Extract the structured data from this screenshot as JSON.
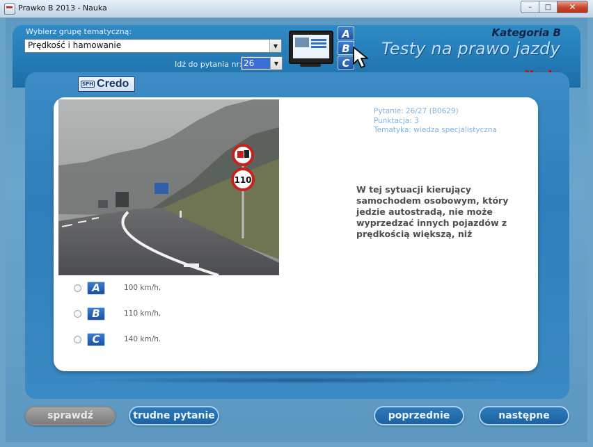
{
  "window": {
    "title": "Prawko B 2013 - Nauka",
    "min_glyph": "–",
    "max_glyph": "□",
    "close_glyph": "✕"
  },
  "header": {
    "group_label": "Wybierz grupę tematyczną:",
    "group_value": "Prędkość i hamowanie",
    "goto_label": "Idź do pytania nr:",
    "goto_value": "26",
    "logo_letters": [
      "A",
      "B",
      "C"
    ],
    "category": "Kategoria B",
    "app_title": "Testy na prawo jazdy",
    "mode": "Nauka"
  },
  "brand": {
    "badge": "SPH",
    "name": "Credo"
  },
  "question": {
    "meta_number": "Pytanie: 26/27 (B0629)",
    "meta_points": "Punktacja: 3",
    "meta_topic": "Tematyka: wiedza specjalistyczna",
    "text": "W tej sytuacji kierujący samochodem osobowym, który jedzie autostradą, nie może wyprzedzać innych pojazdów z prędkością większą, niż",
    "sign_speed": "110",
    "answers": [
      {
        "letter": "A",
        "text": "100 km/h,"
      },
      {
        "letter": "B",
        "text": "110 km/h,"
      },
      {
        "letter": "C",
        "text": "140 km/h."
      }
    ]
  },
  "buttons": {
    "check": "sprawdź",
    "hard": "trudne pytanie",
    "prev": "poprzednie",
    "next": "następne"
  },
  "colors": {
    "accent": "#2f8bc6",
    "mode_red": "#d1101d",
    "meta_blue": "#7fb2de"
  }
}
